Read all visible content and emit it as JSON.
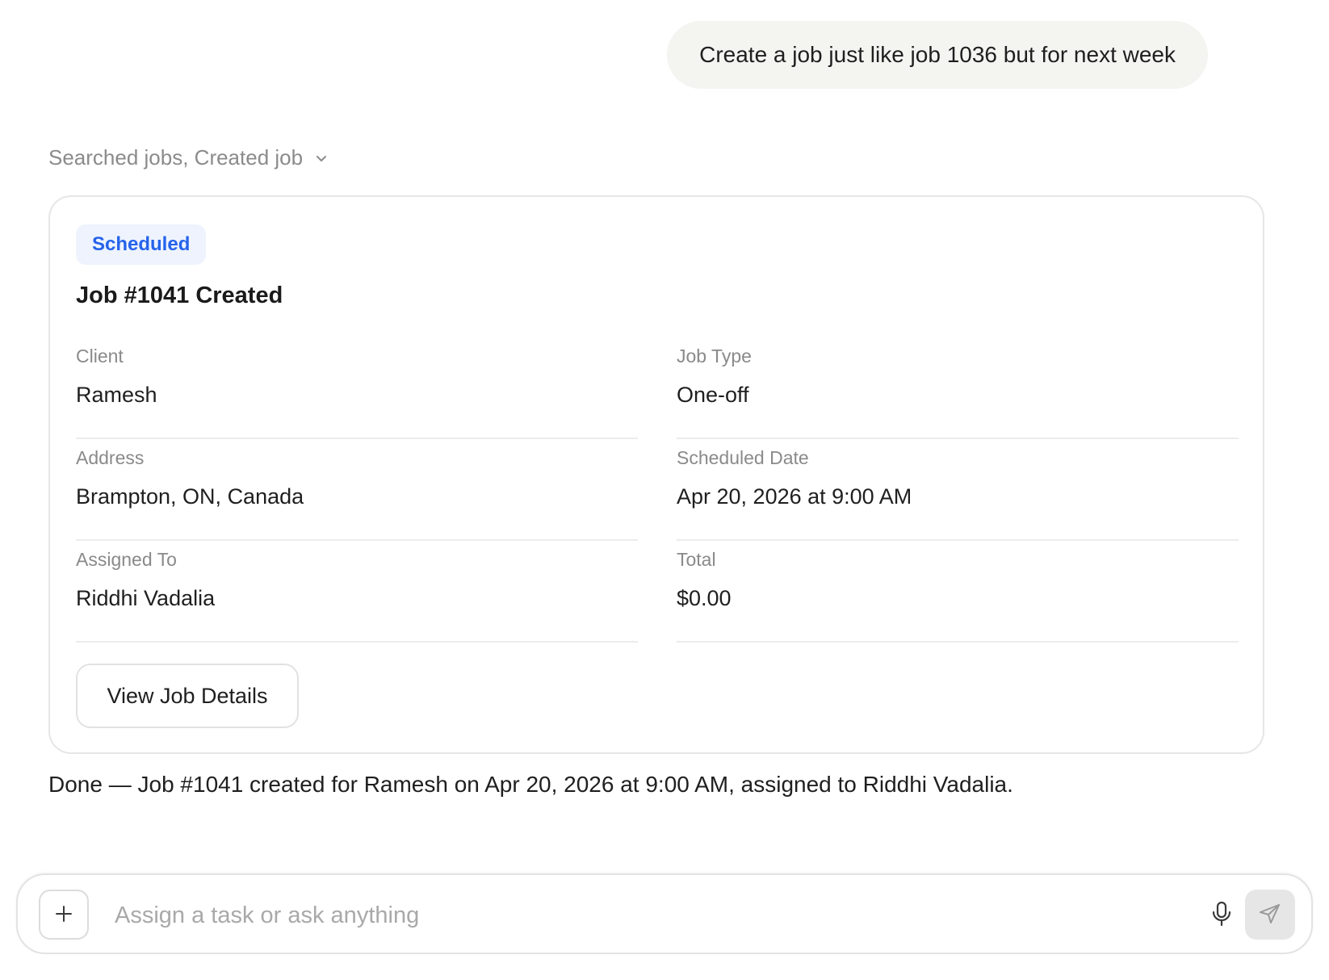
{
  "user_message": "Create a job just like job 1036 but for next week",
  "activity": {
    "label": "Searched jobs, Created job",
    "icon": "chevron-down-icon"
  },
  "job_card": {
    "status_badge": "Scheduled",
    "title": "Job #1041 Created",
    "fields": [
      {
        "label": "Client",
        "value": "Ramesh"
      },
      {
        "label": "Job Type",
        "value": "One-off"
      },
      {
        "label": "Address",
        "value": "Brampton, ON, Canada"
      },
      {
        "label": "Scheduled Date",
        "value": "Apr 20, 2026 at 9:00 AM"
      },
      {
        "label": "Assigned To",
        "value": "Riddhi Vadalia"
      },
      {
        "label": "Total",
        "value": "$0.00"
      }
    ],
    "view_button_label": "View Job Details"
  },
  "assistant_summary": "Done — Job #1041 created for Ramesh on Apr 20, 2026 at 9:00 AM, assigned to Riddhi Vadalia.",
  "composer": {
    "placeholder": "Assign a task or ask anything",
    "value": "",
    "icons": {
      "attach": "plus-icon",
      "voice": "microphone-icon",
      "send": "send-icon"
    }
  },
  "colors": {
    "badge_text": "#2563eb",
    "badge_bg": "#eef3fe",
    "user_bubble_bg": "#f4f4f1",
    "muted_text": "#8a8a8a",
    "send_button_bg": "#e6e6e6"
  }
}
